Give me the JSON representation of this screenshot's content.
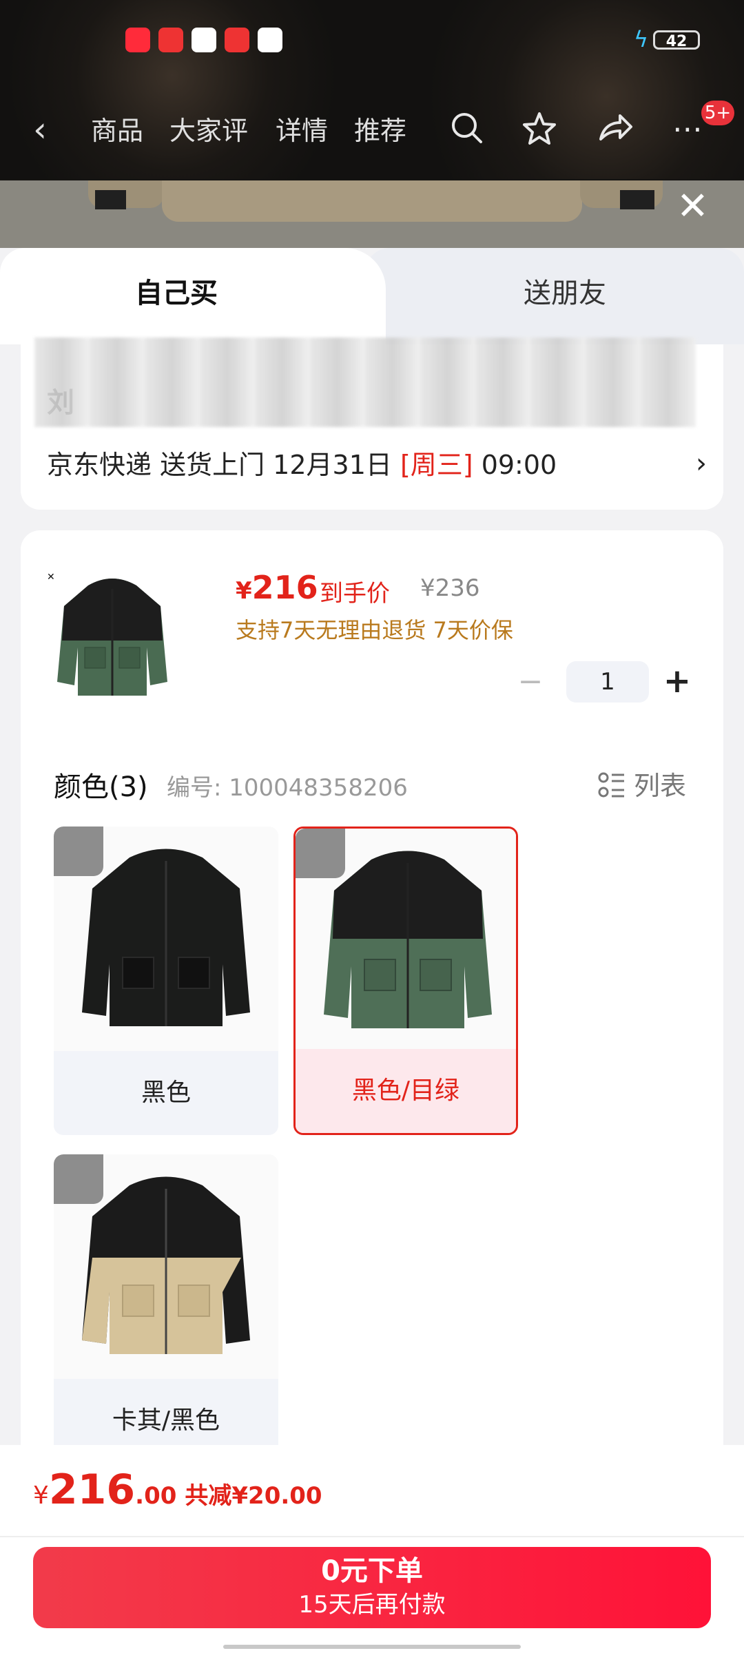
{
  "status_bar": {
    "battery": "42"
  },
  "nav": {
    "tabs": [
      "商品",
      "大家评",
      "详情",
      "推荐"
    ],
    "badge": "5+"
  },
  "sheet": {
    "tab_self": "自己买",
    "tab_gift": "送朋友",
    "address": {
      "name": "刘",
      "delivery_prefix": "京东快递 送货上门 12月31日 ",
      "delivery_day": "[周三]",
      "delivery_suffix": " 09:00",
      "arrow": "›"
    },
    "product": {
      "price_yen": "¥",
      "price": "216",
      "price_tag": "到手价",
      "orig_price": "¥236",
      "perks": "支持7天无理由退货  7天价保",
      "qty": "1",
      "minus": "−",
      "plus": "+"
    },
    "colors": {
      "title": "颜色(3)",
      "sku": "编号: 100048358206",
      "list_label": "列表",
      "options": [
        {
          "label": "黑色",
          "selected": false
        },
        {
          "label": "黑色/目绿",
          "selected": true
        },
        {
          "label": "卡其/黑色",
          "selected": false
        }
      ]
    }
  },
  "bottom": {
    "yen": "¥",
    "int": "216",
    "dec": ".00",
    "save": "共减¥20.00",
    "cta_line1": "0元下单",
    "cta_line2": "15天后再付款"
  },
  "colors_theme": {
    "accent": "#e2231a",
    "perk": "#b97a1e",
    "cta": "#ff1238"
  }
}
